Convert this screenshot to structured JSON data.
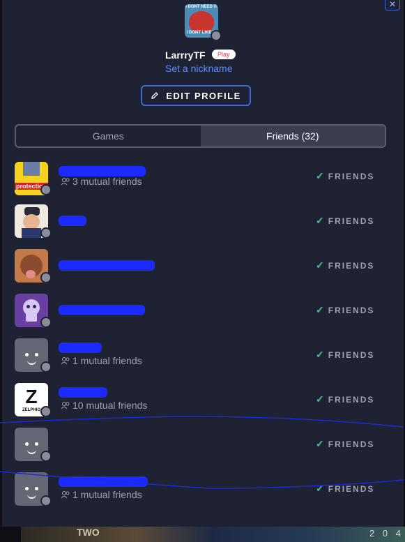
{
  "close_icon": "close-icon",
  "profile": {
    "avatar_caption_top": "I DONT NEED IT",
    "avatar_caption_bottom": "I DONT LIKE IT",
    "username": "LarrryTF",
    "badge": "Play",
    "nickname_link": "Set a nickname",
    "edit_label": "EDIT PROFILE"
  },
  "tabs": [
    {
      "label": "Games",
      "active": false
    },
    {
      "label": "Friends (32)",
      "active": true
    }
  ],
  "friend_status_label": "FRIENDS",
  "friends": [
    {
      "mutual": "3 mutual friends",
      "avatar": "protection-sign"
    },
    {
      "mutual": "",
      "avatar": "cartoon-character"
    },
    {
      "mutual": "",
      "avatar": "face-photo"
    },
    {
      "mutual": "",
      "avatar": "purple-skull"
    },
    {
      "mutual": "1 mutual friends",
      "avatar": "default-bot"
    },
    {
      "mutual": "10 mutual friends",
      "avatar": "zelphion-logo"
    },
    {
      "mutual": "",
      "avatar": "default-bot"
    },
    {
      "mutual": "1 mutual friends",
      "avatar": "default-bot"
    }
  ],
  "avatar_texts": {
    "protection": "protection",
    "zelphion": "ZELPHIO"
  },
  "background_strip": {
    "left_text": "TWO",
    "right_text": "2 0 4"
  },
  "colors": {
    "panel": "#1f2233",
    "accent": "#3b6bd6",
    "link": "#5a8dff",
    "check": "#40c98a",
    "badge_text": "#e2394c"
  }
}
